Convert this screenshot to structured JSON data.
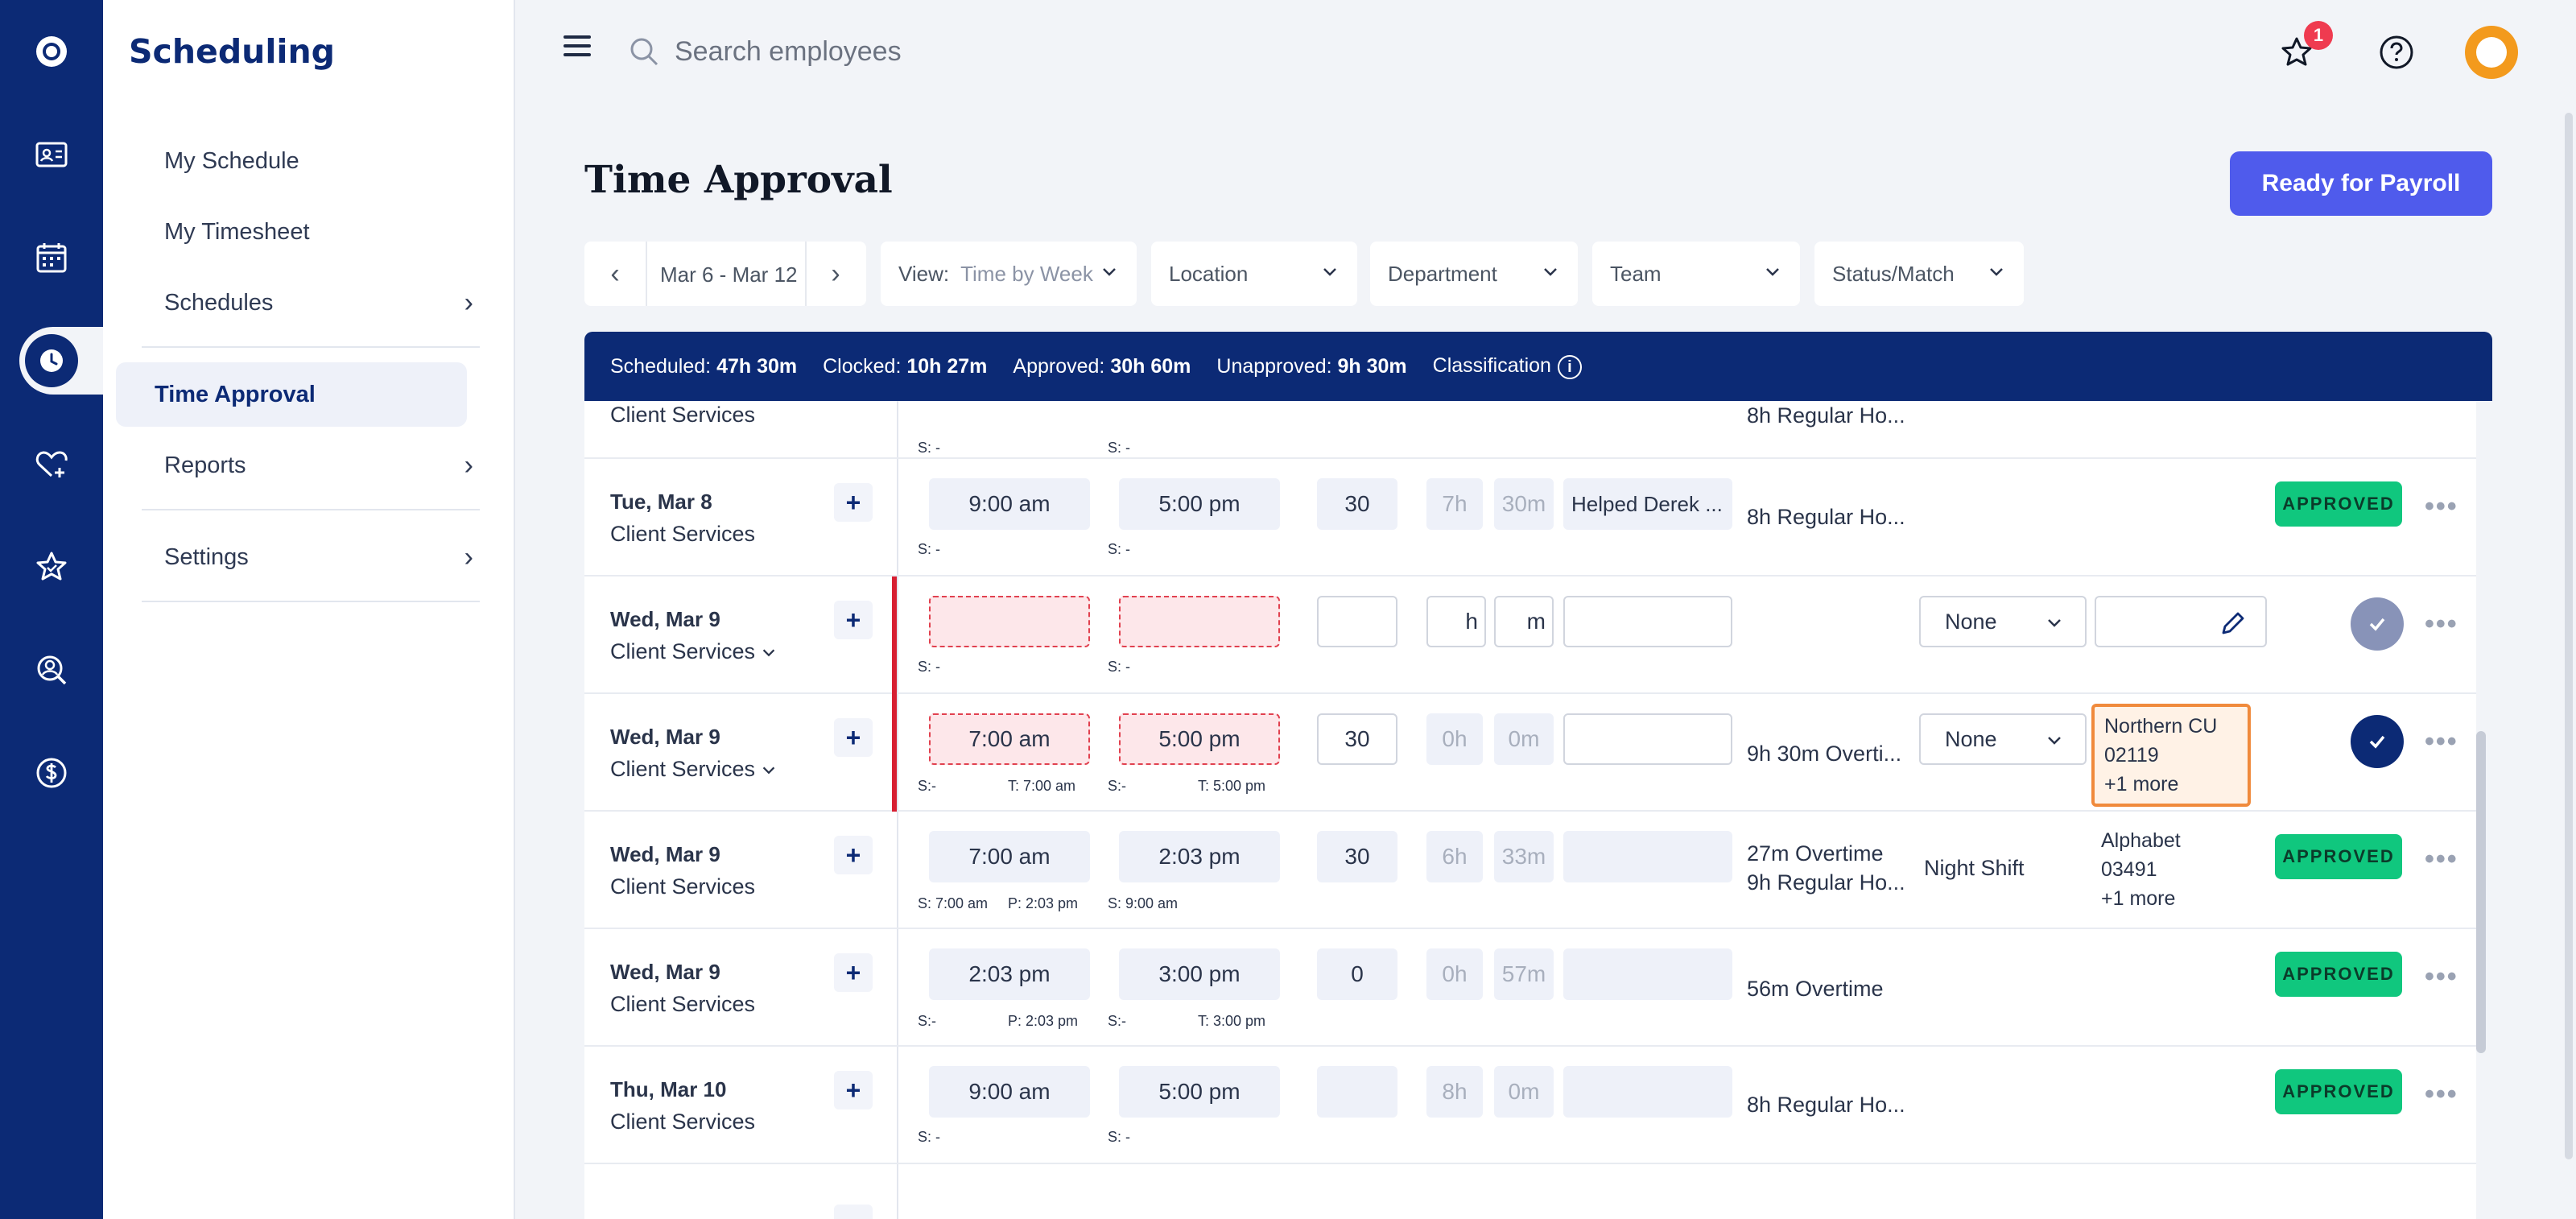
{
  "app": {
    "brand": "Scheduling"
  },
  "sidebar": {
    "items": [
      {
        "label": "My Schedule"
      },
      {
        "label": "My Timesheet"
      },
      {
        "label": "Schedules",
        "chevron": "›"
      },
      {
        "label": "Time Approval"
      },
      {
        "label": "Reports",
        "chevron": "›"
      },
      {
        "label": "Settings",
        "chevron": "›"
      }
    ]
  },
  "topbar": {
    "search_placeholder": "Search employees",
    "notifications_count": "1"
  },
  "page": {
    "title": "Time Approval",
    "ready_label": "Ready for Payroll"
  },
  "filters": {
    "date_range": "Mar 6 - Mar 12",
    "prev": "‹",
    "next": "›",
    "view_label": "View:",
    "view_value": "Time by Week",
    "location": "Location",
    "department": "Department",
    "team": "Team",
    "status": "Status/Match"
  },
  "summary": {
    "scheduled_label": "Scheduled:",
    "scheduled": "47h 30m",
    "clocked_label": "Clocked:",
    "clocked": "10h 27m",
    "approved_label": "Approved:",
    "approved": "30h 60m",
    "unapproved_label": "Unapproved:",
    "unapproved": "9h 30m",
    "classification": "Classification",
    "info": "i"
  },
  "table": {
    "partial_row": {
      "dept": "Client Services",
      "s_in": "S: -",
      "s_out": "S: -",
      "summary": "8h Regular Ho..."
    },
    "rows": [
      {
        "date": "Tue, Mar 8",
        "dept": "Client Services",
        "plus": "+",
        "in": "9:00 am",
        "out": "5:00 pm",
        "break": "30",
        "h": "7h",
        "m": "30m",
        "note": "Helped Derek ...",
        "s_in": "S: -",
        "s_out": "S: -",
        "summary": "8h Regular Ho...",
        "status": "APPROVED",
        "more": "•••"
      },
      {
        "date": "Wed, Mar 9",
        "dept": "Client Services",
        "plus": "+",
        "in": "",
        "out": "",
        "break": "",
        "h": "h",
        "m": "m",
        "note": "",
        "s_in": "S: -",
        "s_out": "S: -",
        "select": "None",
        "more": "•••"
      },
      {
        "date": "Wed, Mar 9",
        "dept": "Client Services",
        "plus": "+",
        "in": "7:00 am",
        "out": "5:00 pm",
        "break": "30",
        "h": "0h",
        "m": "0m",
        "note": "",
        "s_in": "S:-",
        "t_in": "T: 7:00 am",
        "s_out": "S:-",
        "t_out": "T: 5:00 pm",
        "summary": "9h 30m Overti...",
        "select": "None",
        "loc1": "Northern CU",
        "loc2": "02119",
        "loc3": "+1 more",
        "more": "•••"
      },
      {
        "date": "Wed, Mar 9",
        "dept": "Client Services",
        "plus": "+",
        "in": "7:00 am",
        "out": "2:03 pm",
        "break": "30",
        "h": "6h",
        "m": "33m",
        "s_in": "S: 7:00 am",
        "p_in": "P: 2:03 pm",
        "s_out": "S: 9:00 am",
        "summary1": "27m Overtime",
        "summary2": "9h Regular Ho...",
        "shift": "Night Shift",
        "loc1": "Alphabet",
        "loc2": "03491",
        "loc3": "+1 more",
        "status": "APPROVED",
        "more": "•••"
      },
      {
        "date": "Wed, Mar 9",
        "dept": "Client Services",
        "plus": "+",
        "in": "2:03 pm",
        "out": "3:00 pm",
        "break": "0",
        "h": "0h",
        "m": "57m",
        "s_in": "S:-",
        "p_in": "P: 2:03 pm",
        "s_out": "S:-",
        "t_out": "T: 3:00 pm",
        "summary": "56m Overtime",
        "status": "APPROVED",
        "more": "•••"
      },
      {
        "date": "Thu, Mar 10",
        "dept": "Client Services",
        "plus": "+",
        "in": "9:00 am",
        "out": "5:00 pm",
        "break": "",
        "h": "8h",
        "m": "0m",
        "s_in": "S: -",
        "s_out": "S: -",
        "summary": "8h Regular Ho...",
        "status": "APPROVED",
        "more": "•••"
      }
    ]
  },
  "icons": {
    "rail": [
      "logo-icon",
      "contact-card-icon",
      "calendar-icon",
      "clock-icon",
      "heart-plus-icon",
      "star-icon",
      "person-search-icon",
      "dollar-icon"
    ],
    "top": [
      "star-outline-icon",
      "help-icon",
      "avatar"
    ]
  },
  "colors": {
    "primary": "#0c2a75",
    "accent": "#4f5bec",
    "approved": "#10c77e",
    "error": "#d71f32",
    "highlight": "#f08a3c"
  }
}
